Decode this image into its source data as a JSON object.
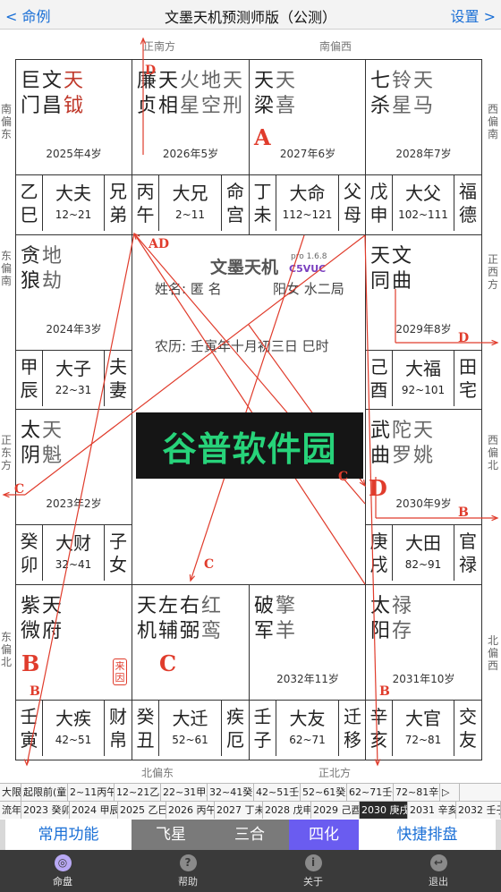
{
  "nav": {
    "back_label": "命例",
    "title": "文墨天机预测师版（公测）",
    "settings_label": "设置"
  },
  "directions": {
    "top_left": "正南方",
    "top_right": "南偏西",
    "bottom_left": "北偏东",
    "bottom_right": "正北方",
    "left_top": "南偏东",
    "left_mid": "东偏南",
    "left_lower": "正东方",
    "left_bottom": "东偏北",
    "right_top": "西偏南",
    "right_mid": "正西方",
    "right_lower": "西偏北",
    "right_bottom": "北偏西"
  },
  "palaces": [
    {
      "id": "si",
      "stars": [
        [
          "巨",
          "门"
        ],
        [
          "文",
          "昌"
        ],
        [
          "天",
          "钺"
        ]
      ],
      "colors": [
        "black",
        "black",
        "red"
      ],
      "age": "2025年4岁",
      "gz": [
        "乙",
        "巳"
      ],
      "name": "大夫",
      "range": "12~21",
      "role": [
        "兄",
        "弟"
      ]
    },
    {
      "id": "wu",
      "stars": [
        [
          "廉",
          "贞"
        ],
        [
          "天",
          "相"
        ],
        [
          "火",
          "星"
        ],
        [
          "地",
          "空"
        ],
        [
          "天",
          "刑"
        ]
      ],
      "colors": [
        "black",
        "black",
        "gray",
        "gray",
        "gray"
      ],
      "age": "2026年5岁",
      "gz": [
        "丙",
        "午"
      ],
      "name": "大兄",
      "range": "2~11",
      "role": [
        "命",
        "宫"
      ]
    },
    {
      "id": "wei",
      "stars": [
        [
          "天",
          "梁"
        ],
        [
          "天",
          "喜"
        ]
      ],
      "colors": [
        "black",
        "gray"
      ],
      "age": "2027年6岁",
      "gz": [
        "丁",
        "未"
      ],
      "name": "大命",
      "range": "112~121",
      "role": [
        "父",
        "母"
      ]
    },
    {
      "id": "shen",
      "stars": [
        [
          "七",
          "杀"
        ],
        [
          "铃",
          "星"
        ],
        [
          "天",
          "马"
        ]
      ],
      "colors": [
        "black",
        "gray",
        "gray"
      ],
      "age": "2028年7岁",
      "gz": [
        "戊",
        "申"
      ],
      "name": "大父",
      "range": "102~111",
      "role": [
        "福",
        "德"
      ]
    },
    {
      "id": "chen",
      "stars": [
        [
          "贪",
          "狼"
        ],
        [
          "地",
          "劫"
        ]
      ],
      "colors": [
        "black",
        "gray"
      ],
      "age": "2024年3岁",
      "gz": [
        "甲",
        "辰"
      ],
      "name": "大子",
      "range": "22~31",
      "role": [
        "夫",
        "妻"
      ]
    },
    {
      "id": "you",
      "stars": [
        [
          "天",
          "同"
        ],
        [
          "文",
          "曲"
        ]
      ],
      "colors": [
        "black",
        "black"
      ],
      "age": "2029年8岁",
      "gz": [
        "己",
        "酉"
      ],
      "name": "大福",
      "range": "92~101",
      "role": [
        "田",
        "宅"
      ]
    },
    {
      "id": "mao",
      "stars": [
        [
          "太",
          "阴"
        ],
        [
          "天",
          "魁"
        ]
      ],
      "colors": [
        "black",
        "gray"
      ],
      "age": "2023年2岁",
      "gz": [
        "癸",
        "卯"
      ],
      "name": "大财",
      "range": "32~41",
      "role": [
        "子",
        "女"
      ]
    },
    {
      "id": "xu",
      "stars": [
        [
          "武",
          "曲"
        ],
        [
          "陀",
          "罗"
        ],
        [
          "天",
          "姚"
        ]
      ],
      "colors": [
        "black",
        "gray",
        "gray"
      ],
      "age": "2030年9岁",
      "gz": [
        "庚",
        "戌"
      ],
      "name": "大田",
      "range": "82~91",
      "role": [
        "官",
        "禄"
      ]
    },
    {
      "id": "yin",
      "stars": [
        [
          "紫",
          "微"
        ],
        [
          "天",
          "府"
        ]
      ],
      "colors": [
        "black",
        "black"
      ],
      "age": "",
      "gz": [
        "壬",
        "寅"
      ],
      "name": "大疾",
      "range": "42~51",
      "role": [
        "财",
        "帛"
      ]
    },
    {
      "id": "chou",
      "stars": [
        [
          "天",
          "机"
        ],
        [
          "左",
          "辅"
        ],
        [
          "右",
          "弼"
        ],
        [
          "红",
          "鸾"
        ]
      ],
      "colors": [
        "black",
        "black",
        "black",
        "gray"
      ],
      "age": "",
      "gz": [
        "癸",
        "丑"
      ],
      "name": "大迁",
      "range": "52~61",
      "role": [
        "疾",
        "厄"
      ]
    },
    {
      "id": "zi",
      "stars": [
        [
          "破",
          "军"
        ],
        [
          "擎",
          "羊"
        ]
      ],
      "colors": [
        "black",
        "gray"
      ],
      "age": "2032年11岁",
      "gz": [
        "壬",
        "子"
      ],
      "name": "大友",
      "range": "62~71",
      "role": [
        "迁",
        "移"
      ]
    },
    {
      "id": "hai",
      "stars": [
        [
          "太",
          "阳"
        ],
        [
          "禄",
          "存"
        ]
      ],
      "colors": [
        "black",
        "gray"
      ],
      "age": "2031年10岁",
      "gz": [
        "辛",
        "亥"
      ],
      "name": "大官",
      "range": "72~81",
      "role": [
        "交",
        "友"
      ]
    }
  ],
  "markers": {
    "wei": "A",
    "xu": "D",
    "yin": "B",
    "chou": "C",
    "flag": "来因"
  },
  "arrow_labels": {
    "top": "D",
    "ad": "AD",
    "right_d": "D",
    "right_b": "B",
    "mid_c": "C",
    "left_c": "C",
    "low_c": "C",
    "left_b": "B",
    "right_b2": "B",
    "right_c": "C"
  },
  "center": {
    "app_name": "文墨天机",
    "version": "pro 1.6.8",
    "edition": "C5VUC",
    "name_label": "姓名: 匿 名",
    "gender_bureau": "阳女 水二局",
    "lunar": "农历: 壬寅年十月初三日 巳时"
  },
  "watermark": "谷普软件园",
  "strip_decade": [
    "大限",
    "起限前(童",
    "2~11丙午",
    "12~21乙巳",
    "22~31甲辰",
    "32~41癸卯",
    "42~51壬寅",
    "52~61癸丑",
    "62~71壬子",
    "72~81辛亥",
    "▷"
  ],
  "strip_year": [
    "流年",
    "2023 癸卯",
    "2024 甲辰",
    "2025 乙巳",
    "2026 丙午",
    "2027 丁未",
    "2028 戊申",
    "2029 己酉",
    "2030 庚戌",
    "2031 辛亥",
    "2032 壬子"
  ],
  "tabs": [
    "常用功能",
    "飞星",
    "三合",
    "四化",
    "快捷排盘"
  ],
  "bottom": [
    "命盘",
    "帮助",
    "关于",
    "退出"
  ],
  "bottom_icons": [
    "disc-icon",
    "question-icon",
    "info-icon",
    "exit-icon"
  ],
  "colors": {
    "accent": "#1a6fd6",
    "red": "#e03c2c",
    "selected_tab": "#6a5cf0"
  }
}
